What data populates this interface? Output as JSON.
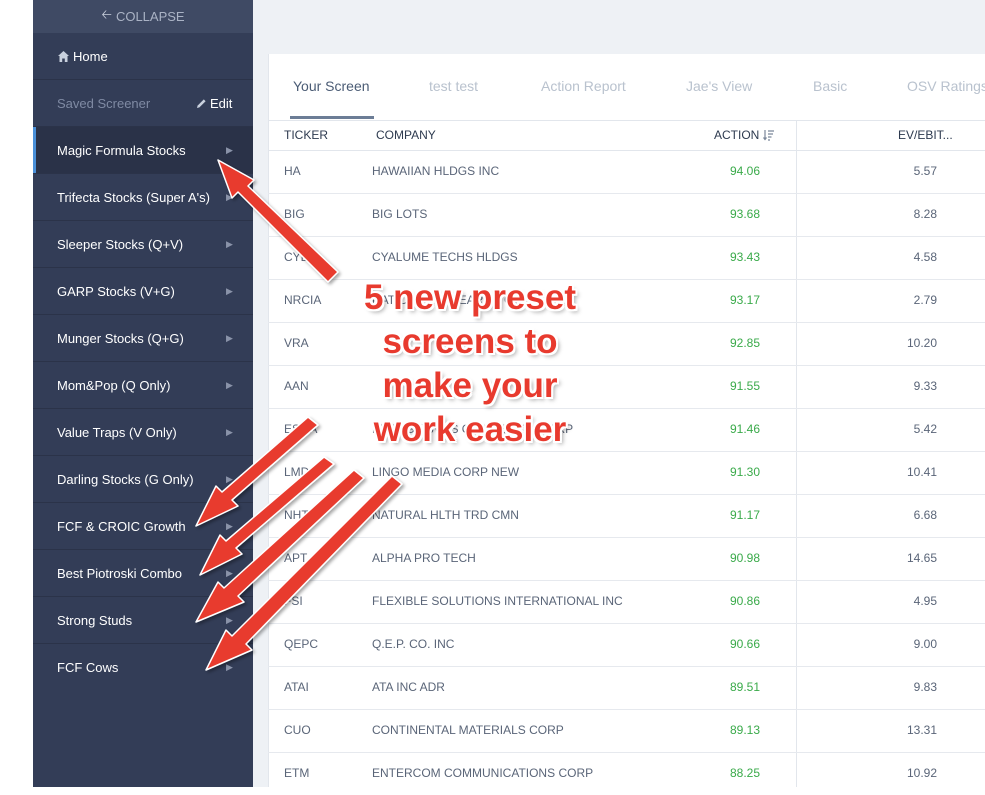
{
  "sidebar": {
    "collapse_label": "COLLAPSE",
    "home_label": "Home",
    "saved_label": "Saved Screener",
    "edit_label": "Edit",
    "items": [
      {
        "label": "Magic Formula Stocks"
      },
      {
        "label": "Trifecta Stocks (Super A's)"
      },
      {
        "label": "Sleeper Stocks (Q+V)"
      },
      {
        "label": "GARP Stocks (V+G)"
      },
      {
        "label": "Munger Stocks (Q+G)"
      },
      {
        "label": "Mom&Pop (Q Only)"
      },
      {
        "label": "Value Traps (V Only)"
      },
      {
        "label": "Darling Stocks (G Only)"
      },
      {
        "label": "FCF & CROIC Growth"
      },
      {
        "label": "Best Piotroski Combo"
      },
      {
        "label": "Strong Studs"
      },
      {
        "label": "FCF Cows"
      }
    ]
  },
  "tabs": [
    "Your Screen",
    "test test",
    "Action Report",
    "Jae's View",
    "Basic",
    "OSV Ratings"
  ],
  "table": {
    "headers": {
      "ticker": "TICKER",
      "company": "COMPANY",
      "action": "ACTION",
      "ev": "EV/EBIT..."
    },
    "rows": [
      {
        "ticker": "HA",
        "company": "HAWAIIAN HLDGS INC",
        "action": "94.06",
        "ev": "5.57"
      },
      {
        "ticker": "BIG",
        "company": "BIG LOTS",
        "action": "93.68",
        "ev": "8.28"
      },
      {
        "ticker": "CYLU",
        "company": "CYALUME TECHS HLDGS",
        "action": "93.43",
        "ev": "4.58"
      },
      {
        "ticker": "NRCIA",
        "company": "NATIONAL RESEARCH CORP",
        "action": "93.17",
        "ev": "2.79"
      },
      {
        "ticker": "VRA",
        "company": "",
        "action": "92.85",
        "ev": "10.20"
      },
      {
        "ticker": "AAN",
        "company": "",
        "action": "91.55",
        "ev": "9.33"
      },
      {
        "ticker": "ESOA",
        "company": "ENERGY SVCS OF AMERICA CORP",
        "action": "91.46",
        "ev": "5.42"
      },
      {
        "ticker": "LMDCF",
        "company": "LINGO MEDIA CORP NEW",
        "action": "91.30",
        "ev": "10.41"
      },
      {
        "ticker": "NHTC",
        "company": "NATURAL HLTH TRD CMN",
        "action": "91.17",
        "ev": "6.68"
      },
      {
        "ticker": "APT",
        "company": "ALPHA PRO TECH",
        "action": "90.98",
        "ev": "14.65"
      },
      {
        "ticker": "FSI",
        "company": "FLEXIBLE SOLUTIONS INTERNATIONAL INC",
        "action": "90.86",
        "ev": "4.95"
      },
      {
        "ticker": "QEPC",
        "company": "Q.E.P. CO. INC",
        "action": "90.66",
        "ev": "9.00"
      },
      {
        "ticker": "ATAI",
        "company": "ATA INC ADR",
        "action": "89.51",
        "ev": "9.83"
      },
      {
        "ticker": "CUO",
        "company": "CONTINENTAL MATERIALS CORP",
        "action": "89.13",
        "ev": "13.31"
      },
      {
        "ticker": "ETM",
        "company": "ENTERCOM COMMUNICATIONS CORP",
        "action": "88.25",
        "ev": "10.92"
      }
    ]
  },
  "annotation": {
    "lines": [
      "5 new preset",
      "screens to",
      "make your",
      "work easier"
    ],
    "color": "#e83a2e"
  },
  "colors": {
    "sidebar_bg": "#333d57",
    "accent": "#4a90d9",
    "action_green": "#3aaa4a"
  }
}
